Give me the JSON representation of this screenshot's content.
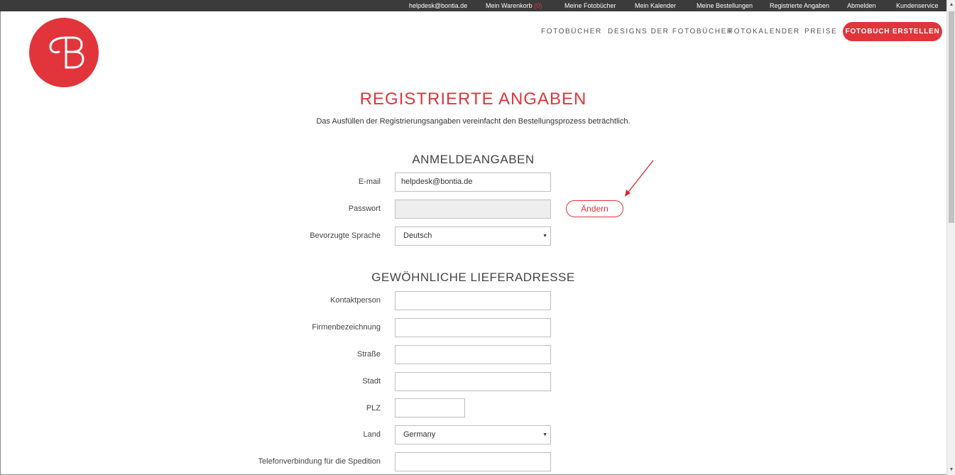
{
  "topbar": {
    "email": "helpdesk@bontia.de",
    "cart_label": "Mein Warenkorb",
    "cart_count": "(0)",
    "photobooks": "Meine Fotobücher",
    "calendars": "Mein Kalender",
    "orders": "Meine Bestellungen",
    "registered_data": "Registrierte Angaben",
    "logout": "Abmelden",
    "service": "Kundenservice"
  },
  "brand": {
    "logo_icon": "bontia-b-logo-icon",
    "color": "#e2343b"
  },
  "nav": {
    "items": [
      "FOTOBÜCHER",
      "DESIGNS DER FOTOBÜCHER",
      "FOTOKALENDER",
      "PREISE"
    ],
    "cta": "FOTOBUCH ERSTELLEN"
  },
  "page": {
    "title": "REGISTRIERTE ANGABEN",
    "subtitle": "Das Ausfüllen der Registrierungsangaben vereinfacht den Bestellungsprozess beträchtlich."
  },
  "login_section": {
    "title": "ANMELDEANGABEN",
    "email_label": "E-mail",
    "email_value": "helpdesk@bontia.de",
    "password_label": "Passwort",
    "password_value": "",
    "change_button": "Ändern",
    "language_label": "Bevorzugte Sprache",
    "language_value": "Deutsch"
  },
  "address_section": {
    "title": "GEWÖHNLICHE LIEFERADRESSE",
    "contact_label": "Kontaktperson",
    "company_label": "Firmenbezeichnung",
    "street_label": "Straße",
    "city_label": "Stadt",
    "zip_label": "PLZ",
    "country_label": "Land",
    "country_value": "Germany",
    "phone_label": "Telefonverbindung für die Spedition"
  }
}
